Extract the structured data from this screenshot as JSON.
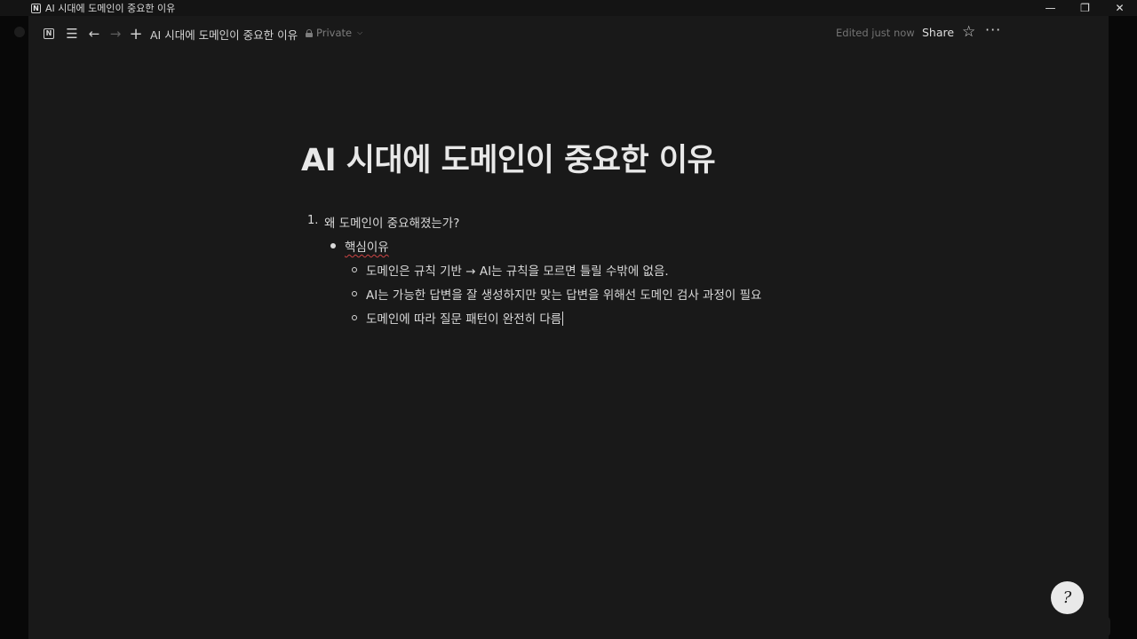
{
  "window": {
    "title": "AI 시대에 도메인이 중요한 이유"
  },
  "topbar": {
    "page_title": "AI 시대에 도메인이 중요한 이유",
    "privacy": "Private",
    "edited": "Edited just now",
    "share": "Share"
  },
  "document": {
    "title": "AI 시대에 도메인이 중요한 이유",
    "items": [
      {
        "number": "1.",
        "text": "왜 도메인이 중요해졌는가?"
      }
    ],
    "bullet_l2": "핵심이유",
    "bullets_l3": [
      "도메인은 규칙 기반 → AI는 규칙을 모르면 틀릴 수밖에 없음.",
      "AI는 가능한 답변을 잘 생성하지만 맞는 답변을 위해선 도메인 검사 과정이 필요",
      "도메인에 따라 질문 패턴이 완전히 다름"
    ]
  },
  "icons": {
    "app": "notion-icon",
    "help": "help-icon"
  }
}
